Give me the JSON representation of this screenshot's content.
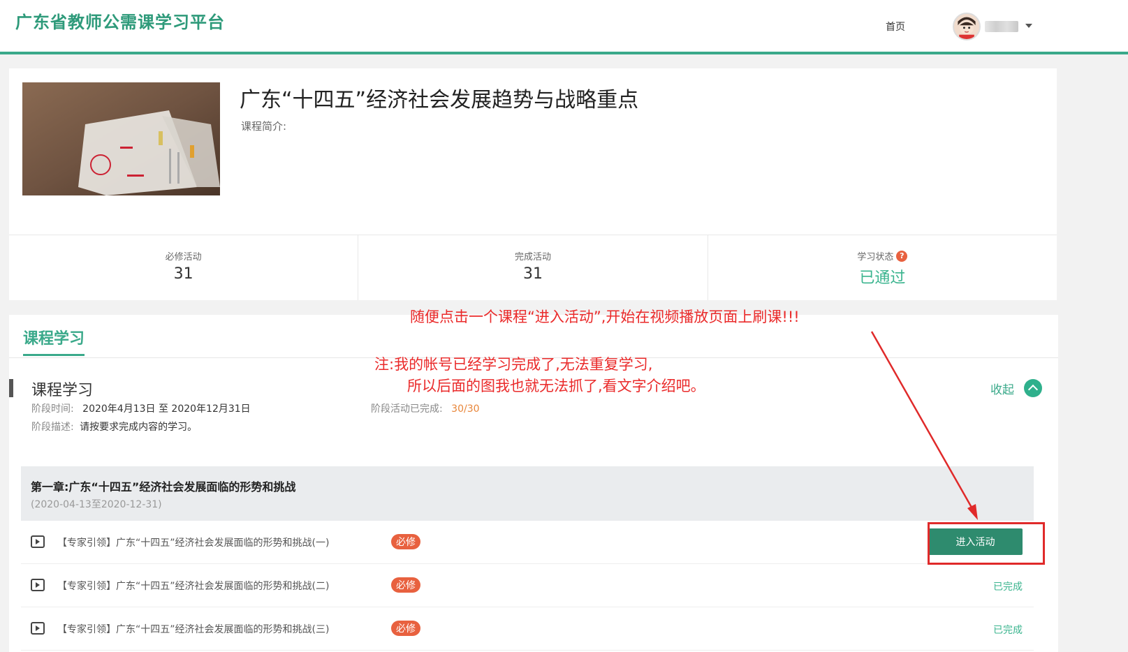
{
  "header": {
    "brand": "广东省教师公需课学习平台",
    "nav_home": "首页",
    "accent_color": "#3aa98a"
  },
  "course": {
    "title": "广东“十四五”经济社会发展趋势与战略重点",
    "intro_label": "课程简介:"
  },
  "stats": [
    {
      "label": "必修活动",
      "value": "31"
    },
    {
      "label": "完成活动",
      "value": "31"
    },
    {
      "label": "学习状态",
      "value": "已通过",
      "help_icon": "?"
    }
  ],
  "learning": {
    "tab_label": "课程学习",
    "section_title": "课程学习",
    "collapse_label": "收起",
    "period_label": "阶段时间:",
    "period_value": "2020年4月13日 至 2020年12月31日",
    "progress_label": "阶段活动已完成:",
    "progress_value": "30/30",
    "desc_label": "阶段描述:",
    "desc_value": "请按要求完成内容的学习。"
  },
  "chapter": {
    "title": "第一章:广东“十四五”经济社会发展面临的形势和挑战",
    "date_range": "(2020-04-13至2020-12-31)"
  },
  "activities": [
    {
      "title": "【专家引领】广东“十四五”经济社会发展面临的形势和挑战(一)",
      "badge": "必修",
      "action": "进入活动"
    },
    {
      "title": "【专家引领】广东“十四五”经济社会发展面临的形势和挑战(二)",
      "badge": "必修",
      "action": "已完成"
    },
    {
      "title": "【专家引领】广东“十四五”经济社会发展面临的形势和挑战(三)",
      "badge": "必修",
      "action": "已完成"
    }
  ],
  "annotations": {
    "line1": "随便点击一个课程“进入活动”,开始在视频播放页面上刷课!!!",
    "line2": "注:我的帐号已经学习完成了,无法重复学习,",
    "line3": "所以后面的图我也就无法抓了,看文字介绍吧。",
    "color": "#ea2a2a"
  }
}
